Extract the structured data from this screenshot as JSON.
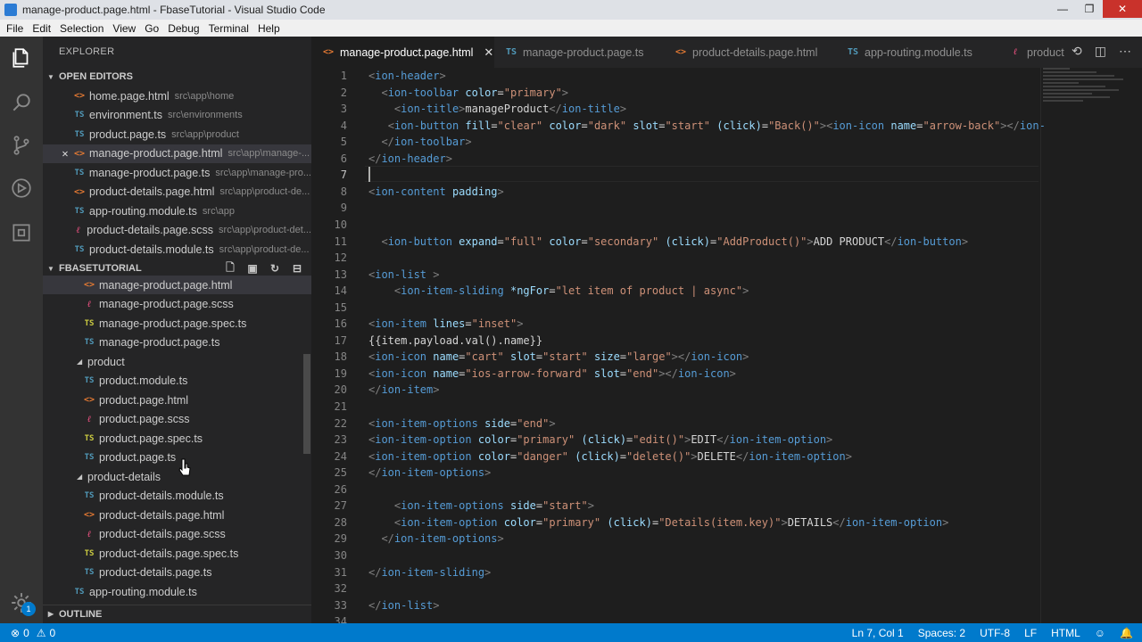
{
  "window": {
    "title": "manage-product.page.html - FbaseTutorial - Visual Studio Code",
    "controls": [
      "—",
      "❐",
      "✕"
    ]
  },
  "menu": [
    "File",
    "Edit",
    "Selection",
    "View",
    "Go",
    "Debug",
    "Terminal",
    "Help"
  ],
  "activity_bar": {
    "icons": [
      "files-icon",
      "search-icon",
      "source-control-icon",
      "debug-icon",
      "extensions-icon"
    ],
    "settings_badge": "1"
  },
  "sidebar": {
    "title": "EXPLORER",
    "open_editors": {
      "label": "OPEN EDITORS",
      "items": [
        {
          "type": "html",
          "name": "home.page.html",
          "path": "src\\app\\home"
        },
        {
          "type": "ts",
          "name": "environment.ts",
          "path": "src\\environments"
        },
        {
          "type": "ts",
          "name": "product.page.ts",
          "path": "src\\app\\product"
        },
        {
          "type": "html",
          "name": "manage-product.page.html",
          "path": "src\\app\\manage-...",
          "active": true
        },
        {
          "type": "ts",
          "name": "manage-product.page.ts",
          "path": "src\\app\\manage-pro..."
        },
        {
          "type": "html",
          "name": "product-details.page.html",
          "path": "src\\app\\product-de..."
        },
        {
          "type": "ts",
          "name": "app-routing.module.ts",
          "path": "src\\app"
        },
        {
          "type": "scss",
          "name": "product-details.page.scss",
          "path": "src\\app\\product-det..."
        },
        {
          "type": "ts",
          "name": "product-details.module.ts",
          "path": "src\\app\\product-de..."
        }
      ]
    },
    "project": {
      "label": "FBASETUTORIAL",
      "items": [
        {
          "kind": "file",
          "type": "html",
          "name": "manage-product.page.html",
          "indent": 2
        },
        {
          "kind": "file",
          "type": "scss",
          "name": "manage-product.page.scss",
          "indent": 2
        },
        {
          "kind": "file",
          "type": "spec",
          "name": "manage-product.page.spec.ts",
          "indent": 2
        },
        {
          "kind": "file",
          "type": "ts",
          "name": "manage-product.page.ts",
          "indent": 2
        },
        {
          "kind": "folder",
          "name": "product",
          "indent": 1
        },
        {
          "kind": "file",
          "type": "ts",
          "name": "product.module.ts",
          "indent": 2
        },
        {
          "kind": "file",
          "type": "html",
          "name": "product.page.html",
          "indent": 2
        },
        {
          "kind": "file",
          "type": "scss",
          "name": "product.page.scss",
          "indent": 2
        },
        {
          "kind": "file",
          "type": "spec",
          "name": "product.page.spec.ts",
          "indent": 2
        },
        {
          "kind": "file",
          "type": "ts",
          "name": "product.page.ts",
          "indent": 2
        },
        {
          "kind": "folder",
          "name": "product-details",
          "indent": 1
        },
        {
          "kind": "file",
          "type": "ts",
          "name": "product-details.module.ts",
          "indent": 2
        },
        {
          "kind": "file",
          "type": "html",
          "name": "product-details.page.html",
          "indent": 2
        },
        {
          "kind": "file",
          "type": "scss",
          "name": "product-details.page.scss",
          "indent": 2
        },
        {
          "kind": "file",
          "type": "spec",
          "name": "product-details.page.spec.ts",
          "indent": 2
        },
        {
          "kind": "file",
          "type": "ts",
          "name": "product-details.page.ts",
          "indent": 2
        },
        {
          "kind": "file",
          "type": "ts",
          "name": "app-routing.module.ts",
          "indent": 1
        }
      ]
    },
    "outline_label": "OUTLINE"
  },
  "tabs": [
    {
      "type": "html",
      "name": "manage-product.page.html",
      "active": true
    },
    {
      "type": "ts",
      "name": "manage-product.page.ts"
    },
    {
      "type": "html",
      "name": "product-details.page.html"
    },
    {
      "type": "ts",
      "name": "app-routing.module.ts"
    },
    {
      "type": "scss",
      "name": "product"
    }
  ],
  "editor": {
    "cursor_line": 7,
    "lines": [
      [
        [
          "p",
          "<"
        ],
        [
          "t",
          "ion-header"
        ],
        [
          "p",
          ">"
        ]
      ],
      [
        [
          "x",
          "  "
        ],
        [
          "p",
          "<"
        ],
        [
          "t",
          "ion-toolbar"
        ],
        [
          "x",
          " "
        ],
        [
          "a",
          "color"
        ],
        [
          "x",
          "="
        ],
        [
          "s",
          "\"primary\""
        ],
        [
          "p",
          ">"
        ]
      ],
      [
        [
          "x",
          "    "
        ],
        [
          "p",
          "<"
        ],
        [
          "t",
          "ion-title"
        ],
        [
          "p",
          ">"
        ],
        [
          "x",
          "manageProduct"
        ],
        [
          "p",
          "</"
        ],
        [
          "t",
          "ion-title"
        ],
        [
          "p",
          ">"
        ]
      ],
      [
        [
          "x",
          "   "
        ],
        [
          "p",
          "<"
        ],
        [
          "t",
          "ion-button"
        ],
        [
          "x",
          " "
        ],
        [
          "a",
          "fill"
        ],
        [
          "x",
          "="
        ],
        [
          "s",
          "\"clear\""
        ],
        [
          "x",
          " "
        ],
        [
          "a",
          "color"
        ],
        [
          "x",
          "="
        ],
        [
          "s",
          "\"dark\""
        ],
        [
          "x",
          " "
        ],
        [
          "a",
          "slot"
        ],
        [
          "x",
          "="
        ],
        [
          "s",
          "\"start\""
        ],
        [
          "x",
          " "
        ],
        [
          "a",
          "(click)"
        ],
        [
          "x",
          "="
        ],
        [
          "s",
          "\"Back()\""
        ],
        [
          "p",
          "><"
        ],
        [
          "t",
          "ion-icon"
        ],
        [
          "x",
          " "
        ],
        [
          "a",
          "name"
        ],
        [
          "x",
          "="
        ],
        [
          "s",
          "\"arrow-back\""
        ],
        [
          "p",
          "></"
        ],
        [
          "t",
          "ion-"
        ]
      ],
      [
        [
          "x",
          "  "
        ],
        [
          "p",
          "</"
        ],
        [
          "t",
          "ion-toolbar"
        ],
        [
          "p",
          ">"
        ]
      ],
      [
        [
          "p",
          "</"
        ],
        [
          "t",
          "ion-header"
        ],
        [
          "p",
          ">"
        ]
      ],
      [],
      [
        [
          "p",
          "<"
        ],
        [
          "t",
          "ion-content"
        ],
        [
          "x",
          " "
        ],
        [
          "a",
          "padding"
        ],
        [
          "p",
          ">"
        ]
      ],
      [],
      [],
      [
        [
          "x",
          "  "
        ],
        [
          "p",
          "<"
        ],
        [
          "t",
          "ion-button"
        ],
        [
          "x",
          " "
        ],
        [
          "a",
          "expand"
        ],
        [
          "x",
          "="
        ],
        [
          "s",
          "\"full\""
        ],
        [
          "x",
          " "
        ],
        [
          "a",
          "color"
        ],
        [
          "x",
          "="
        ],
        [
          "s",
          "\"secondary\""
        ],
        [
          "x",
          " "
        ],
        [
          "a",
          "(click)"
        ],
        [
          "x",
          "="
        ],
        [
          "s",
          "\"AddProduct()\""
        ],
        [
          "p",
          ">"
        ],
        [
          "x",
          "ADD PRODUCT"
        ],
        [
          "p",
          "</"
        ],
        [
          "t",
          "ion-button"
        ],
        [
          "p",
          ">"
        ]
      ],
      [],
      [
        [
          "p",
          "<"
        ],
        [
          "t",
          "ion-list"
        ],
        [
          "x",
          " "
        ],
        [
          "p",
          ">"
        ]
      ],
      [
        [
          "x",
          "    "
        ],
        [
          "p",
          "<"
        ],
        [
          "t",
          "ion-item-sliding"
        ],
        [
          "x",
          " "
        ],
        [
          "a",
          "*ngFor"
        ],
        [
          "x",
          "="
        ],
        [
          "s",
          "\"let item of product | async\""
        ],
        [
          "p",
          ">"
        ]
      ],
      [],
      [
        [
          "p",
          "<"
        ],
        [
          "t",
          "ion-item"
        ],
        [
          "x",
          " "
        ],
        [
          "a",
          "lines"
        ],
        [
          "x",
          "="
        ],
        [
          "s",
          "\"inset\""
        ],
        [
          "p",
          ">"
        ]
      ],
      [
        [
          "x",
          "{{item.payload.val().name}}"
        ]
      ],
      [
        [
          "p",
          "<"
        ],
        [
          "t",
          "ion-icon"
        ],
        [
          "x",
          " "
        ],
        [
          "a",
          "name"
        ],
        [
          "x",
          "="
        ],
        [
          "s",
          "\"cart\""
        ],
        [
          "x",
          " "
        ],
        [
          "a",
          "slot"
        ],
        [
          "x",
          "="
        ],
        [
          "s",
          "\"start\""
        ],
        [
          "x",
          " "
        ],
        [
          "a",
          "size"
        ],
        [
          "x",
          "="
        ],
        [
          "s",
          "\"large\""
        ],
        [
          "p",
          "></"
        ],
        [
          "t",
          "ion-icon"
        ],
        [
          "p",
          ">"
        ]
      ],
      [
        [
          "p",
          "<"
        ],
        [
          "t",
          "ion-icon"
        ],
        [
          "x",
          " "
        ],
        [
          "a",
          "name"
        ],
        [
          "x",
          "="
        ],
        [
          "s",
          "\"ios-arrow-forward\""
        ],
        [
          "x",
          " "
        ],
        [
          "a",
          "slot"
        ],
        [
          "x",
          "="
        ],
        [
          "s",
          "\"end\""
        ],
        [
          "p",
          "></"
        ],
        [
          "t",
          "ion-icon"
        ],
        [
          "p",
          ">"
        ]
      ],
      [
        [
          "p",
          "</"
        ],
        [
          "t",
          "ion-item"
        ],
        [
          "p",
          ">"
        ]
      ],
      [],
      [
        [
          "p",
          "<"
        ],
        [
          "t",
          "ion-item-options"
        ],
        [
          "x",
          " "
        ],
        [
          "a",
          "side"
        ],
        [
          "x",
          "="
        ],
        [
          "s",
          "\"end\""
        ],
        [
          "p",
          ">"
        ]
      ],
      [
        [
          "p",
          "<"
        ],
        [
          "t",
          "ion-item-option"
        ],
        [
          "x",
          " "
        ],
        [
          "a",
          "color"
        ],
        [
          "x",
          "="
        ],
        [
          "s",
          "\"primary\""
        ],
        [
          "x",
          " "
        ],
        [
          "a",
          "(click)"
        ],
        [
          "x",
          "="
        ],
        [
          "s",
          "\"edit()\""
        ],
        [
          "p",
          ">"
        ],
        [
          "x",
          "EDIT"
        ],
        [
          "p",
          "</"
        ],
        [
          "t",
          "ion-item-option"
        ],
        [
          "p",
          ">"
        ]
      ],
      [
        [
          "p",
          "<"
        ],
        [
          "t",
          "ion-item-option"
        ],
        [
          "x",
          " "
        ],
        [
          "a",
          "color"
        ],
        [
          "x",
          "="
        ],
        [
          "s",
          "\"danger\""
        ],
        [
          "x",
          " "
        ],
        [
          "a",
          "(click)"
        ],
        [
          "x",
          "="
        ],
        [
          "s",
          "\"delete()\""
        ],
        [
          "p",
          ">"
        ],
        [
          "x",
          "DELETE"
        ],
        [
          "p",
          "</"
        ],
        [
          "t",
          "ion-item-option"
        ],
        [
          "p",
          ">"
        ]
      ],
      [
        [
          "p",
          "</"
        ],
        [
          "t",
          "ion-item-options"
        ],
        [
          "p",
          ">"
        ]
      ],
      [],
      [
        [
          "x",
          "    "
        ],
        [
          "p",
          "<"
        ],
        [
          "t",
          "ion-item-options"
        ],
        [
          "x",
          " "
        ],
        [
          "a",
          "side"
        ],
        [
          "x",
          "="
        ],
        [
          "s",
          "\"start\""
        ],
        [
          "p",
          ">"
        ]
      ],
      [
        [
          "x",
          "    "
        ],
        [
          "p",
          "<"
        ],
        [
          "t",
          "ion-item-option"
        ],
        [
          "x",
          " "
        ],
        [
          "a",
          "color"
        ],
        [
          "x",
          "="
        ],
        [
          "s",
          "\"primary\""
        ],
        [
          "x",
          " "
        ],
        [
          "a",
          "(click)"
        ],
        [
          "x",
          "="
        ],
        [
          "s",
          "\"Details(item.key)\""
        ],
        [
          "p",
          ">"
        ],
        [
          "x",
          "DETAILS"
        ],
        [
          "p",
          "</"
        ],
        [
          "t",
          "ion-item-option"
        ],
        [
          "p",
          ">"
        ]
      ],
      [
        [
          "x",
          "  "
        ],
        [
          "p",
          "</"
        ],
        [
          "t",
          "ion-item-options"
        ],
        [
          "p",
          ">"
        ]
      ],
      [],
      [
        [
          "p",
          "</"
        ],
        [
          "t",
          "ion-item-sliding"
        ],
        [
          "p",
          ">"
        ]
      ],
      [],
      [
        [
          "p",
          "</"
        ],
        [
          "t",
          "ion-list"
        ],
        [
          "p",
          ">"
        ]
      ],
      []
    ]
  },
  "status_bar": {
    "errors": "0",
    "warnings": "0",
    "position": "Ln 7, Col 1",
    "spaces": "Spaces: 2",
    "encoding": "UTF-8",
    "eol": "LF",
    "language": "HTML"
  }
}
